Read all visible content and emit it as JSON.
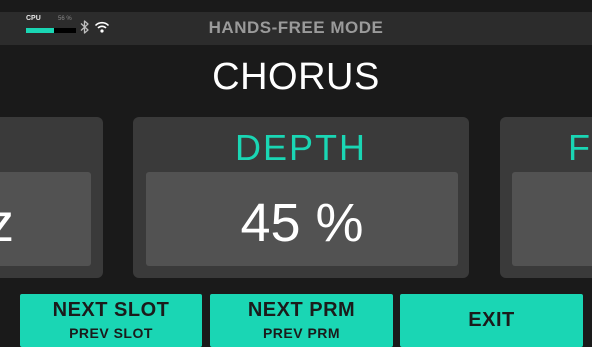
{
  "status_bar": {
    "cpu_label": "CPU",
    "cpu_percent_text": "56 %",
    "cpu_load": 0.56,
    "bluetooth_icon": "bluetooth-icon",
    "wifi_icon": "wifi-icon",
    "mode_title": "HANDS-FREE MODE"
  },
  "effect": {
    "name": "CHORUS"
  },
  "parameters": {
    "previous": {
      "label": "",
      "value": "z"
    },
    "current": {
      "label": "DEPTH",
      "value": "45 %"
    },
    "next": {
      "label": "F",
      "value": ""
    }
  },
  "buttons": {
    "slot": {
      "main": "NEXT SLOT",
      "sub": "PREV SLOT"
    },
    "prm": {
      "main": "NEXT PRM",
      "sub": "PREV PRM"
    },
    "exit": {
      "main": "EXIT"
    }
  },
  "colors": {
    "accent": "#1ad6b4",
    "background": "#1a1a1a",
    "card": "#3a3a3a",
    "value_box": "#525252",
    "status_bar": "#2c2c2c"
  }
}
